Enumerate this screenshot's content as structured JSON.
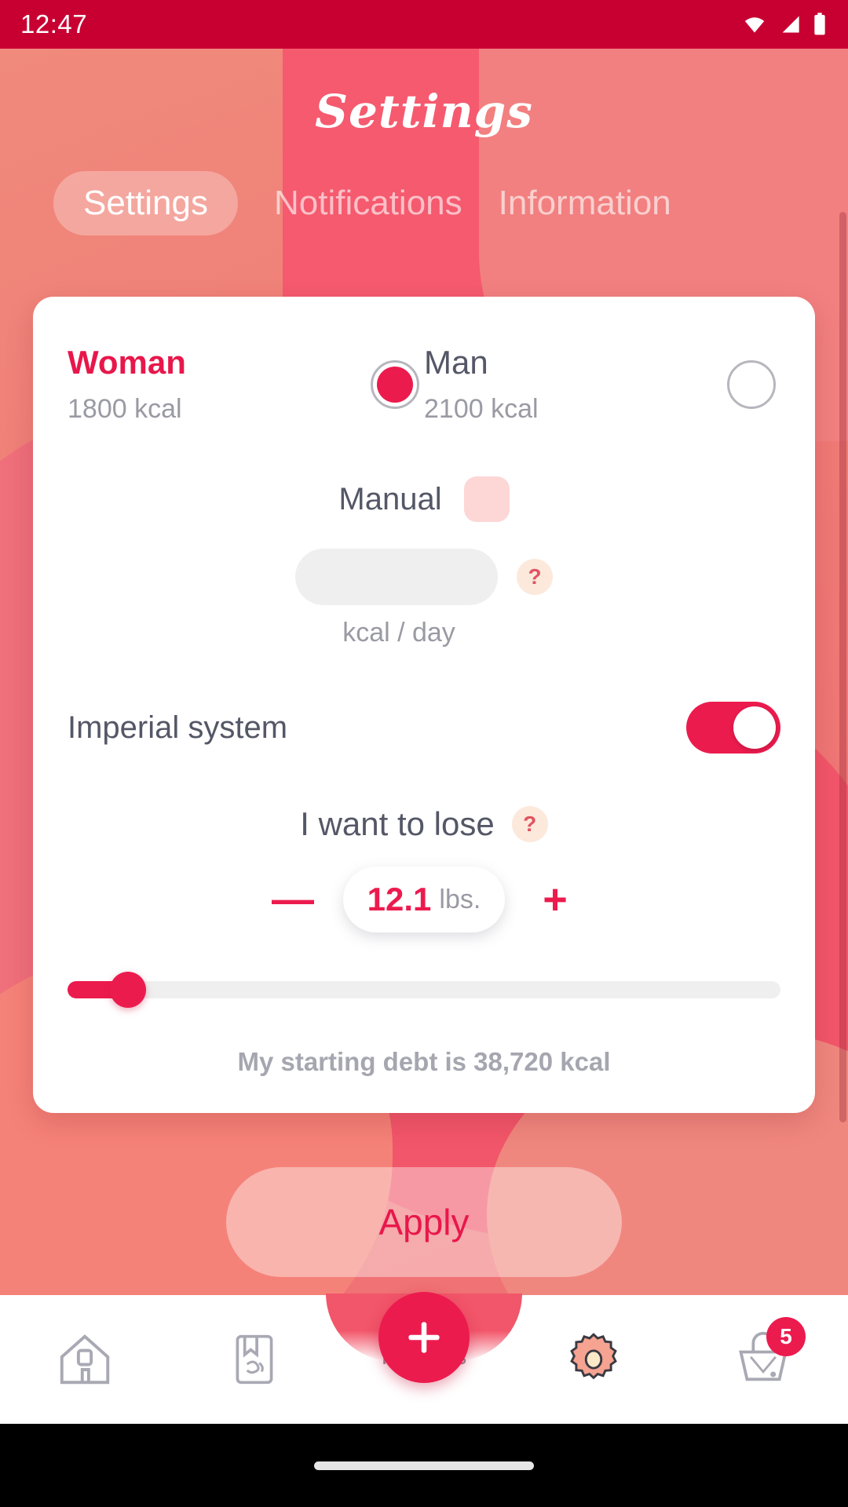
{
  "status_bar": {
    "time": "12:47",
    "icons": [
      "wifi-icon",
      "signal-icon",
      "battery-icon"
    ]
  },
  "header": {
    "title": "Settings",
    "tabs": [
      {
        "label": "Settings",
        "active": true
      },
      {
        "label": "Notifications",
        "active": false
      },
      {
        "label": "Information",
        "active": false
      }
    ]
  },
  "card": {
    "gender": {
      "woman": {
        "name": "Woman",
        "kcal": "1800 kcal",
        "selected": true
      },
      "man": {
        "name": "Man",
        "kcal": "2100 kcal",
        "selected": false
      }
    },
    "manual": {
      "label": "Manual",
      "checked": false,
      "input_value": "",
      "input_placeholder": "",
      "unit": "kcal / day",
      "help": "?"
    },
    "imperial": {
      "label": "Imperial system",
      "enabled": true
    },
    "lose": {
      "label": "I want to lose",
      "help": "?",
      "decrement": "—",
      "increment": "+",
      "value": "12.1",
      "unit": "lbs.",
      "slider_percent": 6
    },
    "debt_text": "My starting debt is 38,720 kcal"
  },
  "apply_button": {
    "label": "Apply"
  },
  "bottom_nav": {
    "items": [
      {
        "name": "home-icon",
        "label": ""
      },
      {
        "name": "recipes-icon",
        "label": ""
      },
      {
        "name": "add-icon",
        "label": "Recipes"
      },
      {
        "name": "gear-icon",
        "label": "",
        "active": true
      },
      {
        "name": "basket-icon",
        "label": "",
        "badge": "5"
      }
    ]
  },
  "colors": {
    "accent": "#ec1b4e",
    "status_bar": "#c80032",
    "background_top": "#f08a7c",
    "background_bottom": "#ef6e74",
    "text_dark": "#545766",
    "text_muted": "#9a9aa4"
  }
}
